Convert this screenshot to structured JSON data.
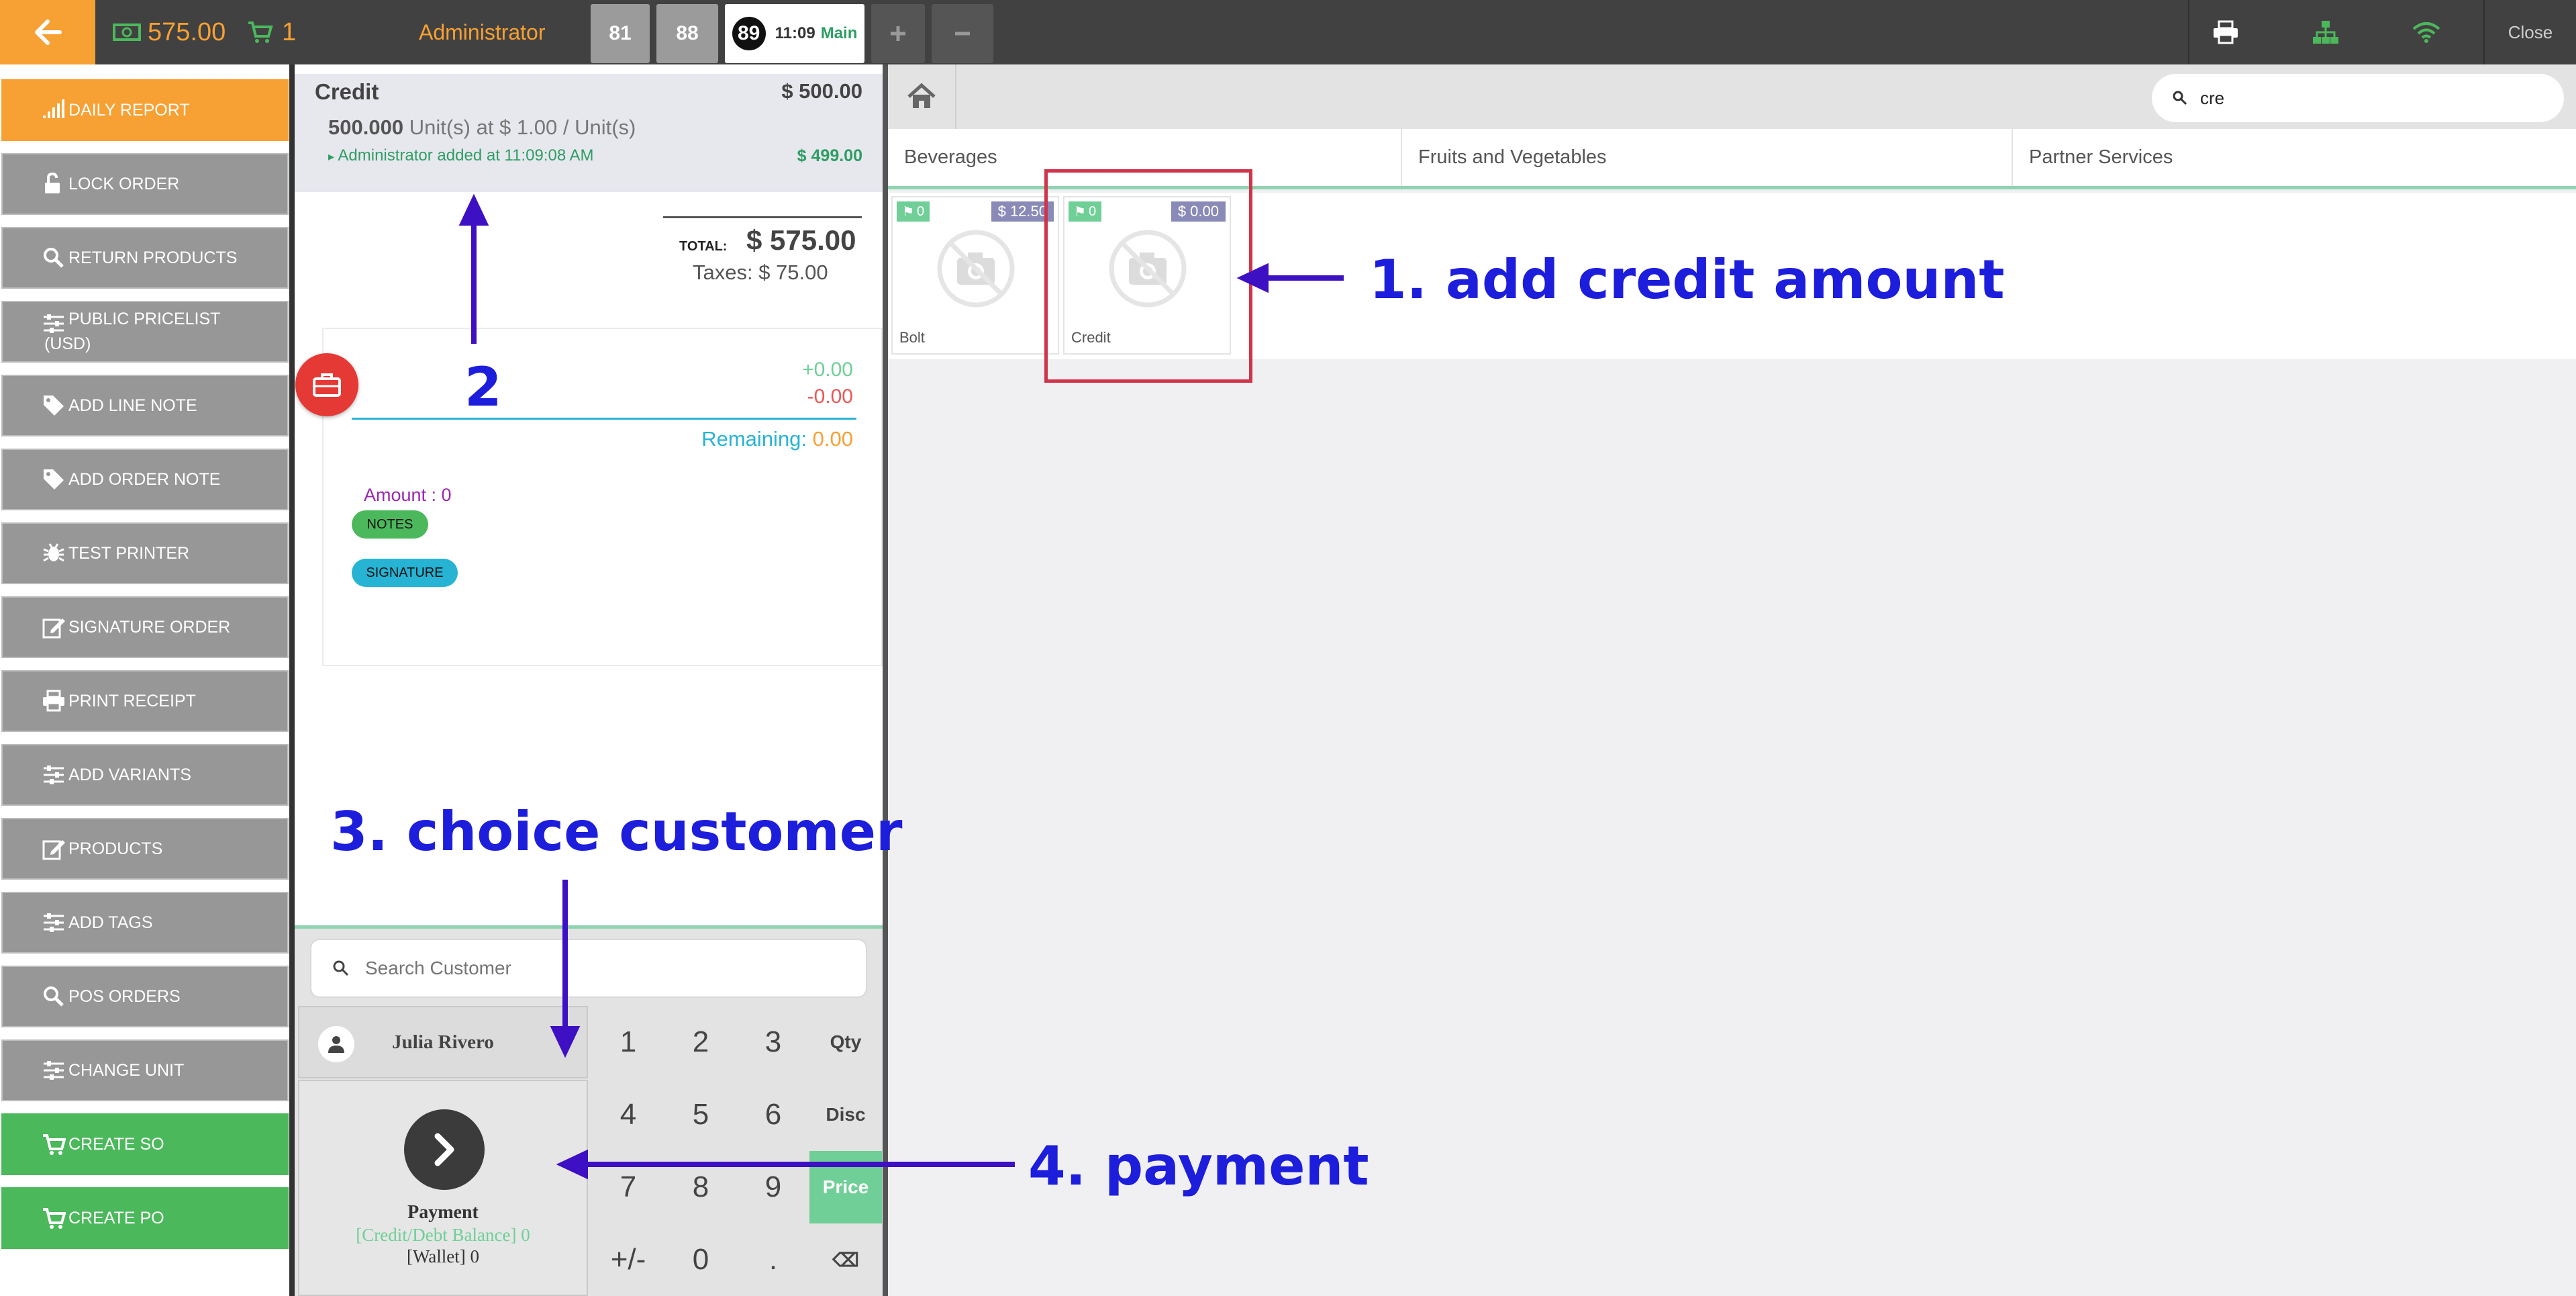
{
  "topbar": {
    "amount": "575.00",
    "cart_count": "1",
    "user": "Administrator",
    "order_tabs": [
      {
        "label": "81"
      },
      {
        "label": "88"
      },
      {
        "label": "89",
        "time": "11:09",
        "location": "Main"
      }
    ],
    "close_label": "Close"
  },
  "sidebar": {
    "items": [
      {
        "label": "DAILY REPORT",
        "icon": "signal-icon",
        "style": "orange"
      },
      {
        "label": "LOCK ORDER",
        "icon": "unlock-icon"
      },
      {
        "label": "RETURN PRODUCTS",
        "icon": "search-icon"
      },
      {
        "label": "PUBLIC PRICELIST",
        "label2": "(USD)",
        "icon": "sliders-icon"
      },
      {
        "label": "ADD LINE NOTE",
        "icon": "tag-icon"
      },
      {
        "label": "ADD ORDER NOTE",
        "icon": "tag-icon"
      },
      {
        "label": "TEST PRINTER",
        "icon": "bug-icon"
      },
      {
        "label": "SIGNATURE ORDER",
        "icon": "edit-icon"
      },
      {
        "label": "PRINT RECEIPT",
        "icon": "printer-icon"
      },
      {
        "label": "ADD VARIANTS",
        "icon": "sliders-icon"
      },
      {
        "label": "PRODUCTS",
        "icon": "edit-icon"
      },
      {
        "label": "ADD TAGS",
        "icon": "sliders-icon"
      },
      {
        "label": "POS ORDERS",
        "icon": "search-icon"
      },
      {
        "label": "CHANGE UNIT",
        "icon": "sliders-icon"
      },
      {
        "label": "CREATE SO",
        "icon": "cart-icon",
        "style": "green"
      },
      {
        "label": "CREATE PO",
        "icon": "cart-icon",
        "style": "green"
      }
    ]
  },
  "order": {
    "line": {
      "name": "Credit",
      "price": "$ 500.00",
      "qty": "500.000",
      "qty_rest": "Unit(s) at $ 1.00 / Unit(s)",
      "note": "Administrator added at 11:09:08 AM",
      "note_amount": "$ 499.00"
    },
    "total_label": "TOTAL:",
    "total_value": "$ 575.00",
    "taxes": "Taxes: $ 75.00",
    "payment_card": {
      "plus": "+0.00",
      "minus": "-0.00",
      "remaining_label": "Remaining: ",
      "remaining_value": "0.00",
      "amount": "Amount : 0",
      "notes_label": "NOTES",
      "signature_label": "SIGNATURE"
    }
  },
  "customer": {
    "search_placeholder": "Search Customer",
    "name": "Julia Rivero"
  },
  "payment": {
    "title": "Payment",
    "credit": "[Credit/Debt Balance] 0",
    "wallet": "[Wallet] 0"
  },
  "keypad": {
    "rows": [
      [
        "1",
        "2",
        "3",
        "Qty"
      ],
      [
        "4",
        "5",
        "6",
        "Disc"
      ],
      [
        "7",
        "8",
        "9",
        "Price"
      ],
      [
        "+/-",
        "0",
        ".",
        "⌫"
      ]
    ],
    "active_mode": "Price"
  },
  "products": {
    "search_value": "cre",
    "categories": [
      "Beverages",
      "Fruits and Vegetables",
      "Partner Services"
    ],
    "items": [
      {
        "name": "Bolt",
        "tag": "0",
        "price": "$ 12.50"
      },
      {
        "name": "Credit",
        "tag": "0",
        "price": "$ 0.00"
      }
    ]
  },
  "annotations": {
    "step1": "1. add credit amount",
    "step2": "2",
    "step3": "3. choice customer",
    "step4": "4. payment"
  },
  "colors": {
    "accent_orange": "#f7a033",
    "accent_green": "#4cb85c",
    "annotation_blue": "#1d1ddc",
    "highlight_red": "#d0344a"
  }
}
